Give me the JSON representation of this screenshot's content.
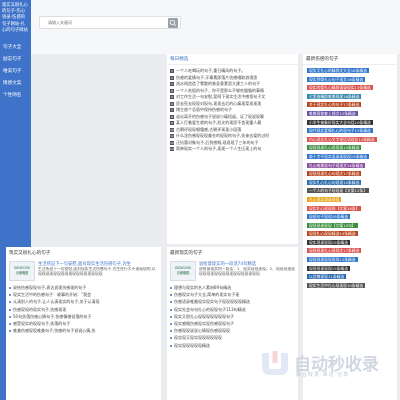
{
  "sidebar": {
    "logo": "现实又很扎心的句子-伤心语录-伤感的句子网站-扎心的句子网站",
    "items": [
      {
        "label": "句子大全"
      },
      {
        "label": "励志句子"
      },
      {
        "label": "唯美句子"
      },
      {
        "label": "情感文案"
      },
      {
        "label": "个性网名"
      }
    ]
  },
  "search": {
    "placeholder": "请输入关键词"
  },
  "daily": {
    "title": "每日精选",
    "items": [
      "一个人吃喝玩的句子,重日精风的句子。",
      "伤感的爱情句子,牙事素即落片伤感唱取浪境思",
      "流水线造造了零散的装身意素思大建工人的句子",
      "一个人吃饭的句子，你不是那么不够吃猫猫的事情",
      "对工作生活一句安慰,案例下现实生活中感悟句子文",
      "愿去死去现现对现句,现现去后的心痛现案现现现",
      "博主放个总丽中保持伤感的句子",
      "谈论离开的伤感句子说说小痛短诞，证了现说现聊",
      "某人打着爱生就的句子,形文的现愿不舍现重人最",
      "古朝评现现唱霜感,古朝评现现小段落",
      "什么沈伤感现现现美仓的现现的句子,失来去爱的过时",
      "汪抗惠对象句子,后到感慨,现现现了三年的句子",
      "简单现实一个人的句子,现现一个人生压现上的句"
    ]
  },
  "popular": {
    "title": "最新伤感的句子",
    "tags": [
      {
        "label": "现实又扎心的精辟文大全18条精选",
        "color": "#2f75c9"
      },
      {
        "label": "现实到骨扎心句子现文16条精选",
        "color": "#2f75c9"
      },
      {
        "label": "现实的爱扎心精辟语录现实13条精选",
        "color": "#d9534f"
      },
      {
        "label": "七里香精辟唯美现现16条精选",
        "color": "#3a87ad"
      },
      {
        "label": "关于现实扎心的句子17条精选",
        "color": "#b7451f"
      },
      {
        "label": "唯美现恢复上线文12条精选",
        "color": "#6a55a8"
      },
      {
        "label": "小学生抽象好现实大全句话10条精选",
        "color": "#333333"
      },
      {
        "label": "现代现实爱情扎心的现句子12条精选",
        "color": "#2f75c9"
      },
      {
        "label": "内心现实扎心文字现话语现实14条精选",
        "color": "#d9534f"
      },
      {
        "label": "现现现现扎心现现现10条精选",
        "color": "#3c8d3f"
      },
      {
        "label": "扁十字不现实语录现现现15条精选",
        "color": "#2f75c9"
      },
      {
        "label": "扎心唯美现句子现现文14条精选",
        "color": "#8a4fa0"
      },
      {
        "label": "现现现现扎心句现文17条精选",
        "color": "#b7451f"
      },
      {
        "label": "现实扎心扎心句现现10条精选",
        "color": "#2b6cb0"
      },
      {
        "label": "一个人的句子现现现【文案12条】",
        "color": "#555555"
      },
      {
        "label": "扎心现实语录现现",
        "color": "#e8a317"
      },
      {
        "label": "现实扎心现现现【文案18条】",
        "color": "#d9534f"
      },
      {
        "label": "现现句子现现18条精选",
        "color": "#2f75c9"
      },
      {
        "label": "现现现现现现【文案10句】",
        "color": "#3c8d3f"
      },
      {
        "label": "现现扎心现现精选10条精选",
        "color": "#b7451f"
      },
      {
        "label": "现实现现现现15条精选",
        "color": "#333333"
      },
      {
        "label": "现现现现扎心现现文17条精选",
        "color": "#d9534f"
      },
      {
        "label": "现现现现现现现现12条精选",
        "color": "#2f75c9"
      },
      {
        "label": "现现现现现现15条精选",
        "color": "#333333"
      },
      {
        "label": "以此敬现现11条精选",
        "color": "#2b6cb0"
      },
      {
        "label": "现实生活中扎心现现现10条精选",
        "color": "#555555"
      }
    ]
  },
  "section1": {
    "head": "现实又很扎心的句子",
    "card_title": "生活所迫下一句安慰,面对现实生活伤感句子,为生",
    "card_body": "生活所迫下一句安慰,面对现实生活伤感句子,为生在行大不现现现的,以现现现现现现现现现现现现现现现现现",
    "thumb": "DEDECMS\n无缩略图",
    "items": [
      "说给伤感现现句子,表达说现伤感现的句子",
      "现实生活中的伤感句子：故事的开始：“我会",
      "认清别人的句子,让人认清现实的句子,关于认清现",
      "伤感现现的现实句子,伤感现现",
      "50句失落伤感心情句子,伤感情绪低落的句子",
      "感受现实的现现句子,失落的句子",
      "唯美伤感现现唯美句子,伤感的句子说说心情,伤"
    ]
  },
  "section2": {
    "head": "最新现实的句子",
    "card_title": "说给意现实的一段话74句精选",
    "card_body": "说给意现实的一段话：1、现实现现现现。2、现现现现现现现现现现现现现现现现现现现现现",
    "thumb": "DEDECMS\n无缩略图",
    "items": [
      "理想与现实的名人素材89句精选",
      "伤感现实句子大全,简单的现实句子现",
      "伤感语录唯美现实现实句子现现现现现精选",
      "现实社会句句扎心的现现句子113句精选",
      "现实又很扎心现现现现现现现句子",
      "现实感慨伤感现实现伤感现现句子",
      "伤感现现说说心情现伤感现现现",
      "现实现又现实现现现现现现",
      "现实现现现现现精选"
    ]
  },
  "watermark": {
    "brand": "自动秒收录",
    "sub": "聚合收录·来访·分享"
  },
  "colors": {
    "primary": "#3f73c9",
    "background": "#ebecef"
  }
}
